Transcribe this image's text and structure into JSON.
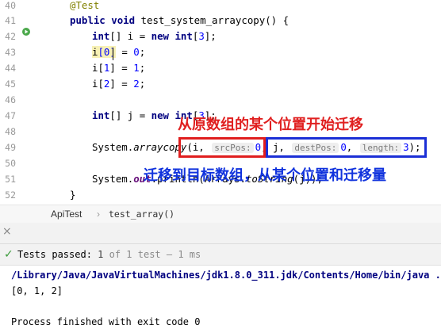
{
  "editor": {
    "lines": [
      {
        "num": "40"
      },
      {
        "num": "41"
      },
      {
        "num": "42"
      },
      {
        "num": "43"
      },
      {
        "num": "44"
      },
      {
        "num": "45"
      },
      {
        "num": "46"
      },
      {
        "num": "47"
      },
      {
        "num": "48"
      },
      {
        "num": "49"
      },
      {
        "num": "50"
      },
      {
        "num": "51"
      },
      {
        "num": "52"
      }
    ],
    "code": {
      "l40_ann": "@Test",
      "l41_kw1": "public",
      "l41_kw2": "void",
      "l41_rest": " test_system_arraycopy() {",
      "l42_kw": "int",
      "l42_a": "[] i = ",
      "l42_new": "new",
      "l42_int": "int",
      "l42_b": "[",
      "l42_num": "3",
      "l42_c": "];",
      "l43_a": "i",
      "l43_b": "[0]",
      "l43_c": " = ",
      "l43_num": "0",
      "l43_d": ";",
      "l44_a": "i[",
      "l44_idx": "1",
      "l44_b": "] = ",
      "l44_num": "1",
      "l44_c": ";",
      "l45_a": "i[",
      "l45_idx": "2",
      "l45_b": "] = ",
      "l45_num": "2",
      "l45_c": ";",
      "l47_kw": "int",
      "l47_a": "[] j = ",
      "l47_new": "new",
      "l47_int": "int",
      "l47_b": "[",
      "l47_num": "3",
      "l47_c": "];",
      "l49_a": "System.",
      "l49_method": "arraycopy",
      "l49_b": "(i, ",
      "l49_hint1": "srcPos:",
      "l49_n1": "0",
      "l49_c": ", j, ",
      "l49_hint2": "destPos:",
      "l49_n2": "0",
      "l49_d": ", ",
      "l49_hint3": "length:",
      "l49_n3": "3",
      "l49_e": ");",
      "l51_a": "System.",
      "l51_field": "out",
      "l51_b": ".println(Arrays.",
      "l51_method": "toString",
      "l51_c": "(j));",
      "l52": "}"
    }
  },
  "annotations": {
    "red_text": "从原数组的某个位置开始迁移",
    "blue_text": "迁移到目标数组，从某个位置和迁移量"
  },
  "breadcrumb": {
    "class_name": "ApiTest",
    "separator": "›",
    "method_name": "test_array()"
  },
  "run_panel": {
    "close_icon": "×",
    "status_icon": "✓",
    "status_label": "Tests passed:",
    "passed_count": "1",
    "status_detail": "of 1 test – 1 ms"
  },
  "console": {
    "java_path": "/Library/Java/JavaVirtualMachines/jdk1.8.0_311.jdk/Contents/Home/bin/java ...",
    "output": "[0, 1, 2]",
    "exit": "Process finished with exit code 0"
  },
  "colors": {
    "keyword": "#000080",
    "annotation": "#808000",
    "number": "#0000ff",
    "red_box": "#e01e1e",
    "blue_box": "#1b2fd6",
    "pass_green": "#3b9b3b"
  }
}
